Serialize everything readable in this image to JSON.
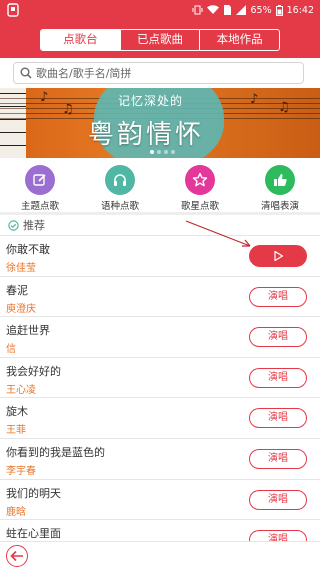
{
  "status_bar": {
    "battery_percent": "65%",
    "time": "16:42"
  },
  "tabs": [
    {
      "label": "点歌台",
      "active": true
    },
    {
      "label": "已点歌曲",
      "active": false
    },
    {
      "label": "本地作品",
      "active": false
    }
  ],
  "search": {
    "placeholder": "歌曲名/歌手名/简拼"
  },
  "banner": {
    "subtitle": "记忆深处的",
    "title": "粤韵情怀"
  },
  "categories": [
    {
      "label": "主题点歌",
      "icon": "edit-icon",
      "color": "#9b6fd1"
    },
    {
      "label": "语种点歌",
      "icon": "headphones-icon",
      "color": "#4fb7a4"
    },
    {
      "label": "歌星点歌",
      "icon": "star-icon",
      "color": "#e3379a"
    },
    {
      "label": "清唱表演",
      "icon": "thumbs-up-icon",
      "color": "#2dbb5d"
    }
  ],
  "recommend": {
    "label": "推荐"
  },
  "songs": [
    {
      "title": "你敢不敢",
      "singer": "徐佳莹",
      "button": ""
    },
    {
      "title": "春泥",
      "singer": "庾澄庆",
      "button": "演唱"
    },
    {
      "title": "追赶世界",
      "singer": "信",
      "button": "演唱"
    },
    {
      "title": "我会好好的",
      "singer": "王心凌",
      "button": "演唱"
    },
    {
      "title": "旋木",
      "singer": "王菲",
      "button": "演唱"
    },
    {
      "title": "你看到的我是蓝色的",
      "singer": "李宇春",
      "button": "演唱"
    },
    {
      "title": "我们的明天",
      "singer": "鹿晗",
      "button": "演唱"
    },
    {
      "title": "蛀在心里面",
      "singer": "",
      "button": "演唱"
    }
  ],
  "colors": {
    "brand": "#e43a47",
    "singer": "#e8742a"
  }
}
